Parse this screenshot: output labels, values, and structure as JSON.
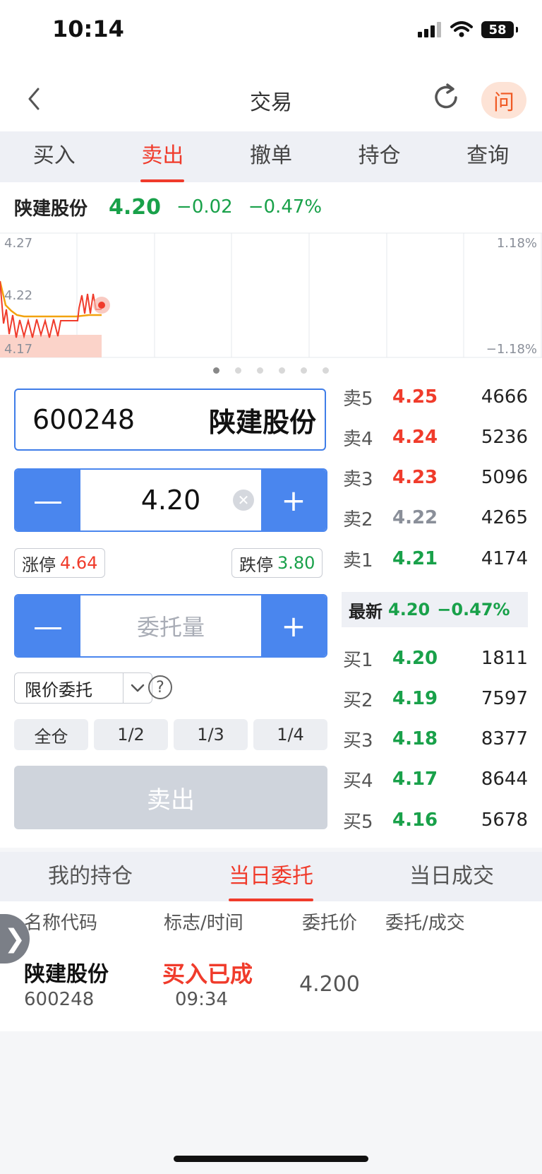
{
  "status": {
    "time": "10:14",
    "battery": "58"
  },
  "header": {
    "title": "交易",
    "ask_label": "问"
  },
  "tabs": [
    {
      "label": "买入"
    },
    {
      "label": "卖出"
    },
    {
      "label": "撤单"
    },
    {
      "label": "持仓"
    },
    {
      "label": "查询"
    }
  ],
  "quote": {
    "name": "陕建股份",
    "price": "4.20",
    "change": "−0.02",
    "change_pct": "−0.47%"
  },
  "chart": {
    "price_labels": {
      "high": "4.27",
      "mid": "4.22",
      "low": "4.17"
    },
    "pct_labels": {
      "high": "1.18%",
      "low": "−1.18%"
    }
  },
  "pager": {
    "count": 6,
    "active": 0
  },
  "form": {
    "stock_code": "600248",
    "stock_name": "陕建股份",
    "minus": "—",
    "plus": "+",
    "price_value": "4.20",
    "clear": "✕",
    "limit_up_label": "涨停",
    "limit_up_value": "4.64",
    "limit_down_label": "跌停",
    "limit_down_value": "3.80",
    "quantity_placeholder": "委托量",
    "order_type": "限价委托",
    "help": "?",
    "qty_buttons": [
      "全仓",
      "1/2",
      "1/3",
      "1/4"
    ],
    "sell_button": "卖出"
  },
  "orderbook": {
    "asks": [
      {
        "label": "卖5",
        "price": "4.25",
        "volume": "4666",
        "color": "red"
      },
      {
        "label": "卖4",
        "price": "4.24",
        "volume": "5236",
        "color": "red"
      },
      {
        "label": "卖3",
        "price": "4.23",
        "volume": "5096",
        "color": "red"
      },
      {
        "label": "卖2",
        "price": "4.22",
        "volume": "4265",
        "color": "gray"
      },
      {
        "label": "卖1",
        "price": "4.21",
        "volume": "4174",
        "color": "green"
      }
    ],
    "latest_label": "最新",
    "latest_price": "4.20",
    "latest_pct": "−0.47%",
    "bids": [
      {
        "label": "买1",
        "price": "4.20",
        "volume": "1811",
        "color": "green"
      },
      {
        "label": "买2",
        "price": "4.19",
        "volume": "7597",
        "color": "green"
      },
      {
        "label": "买3",
        "price": "4.18",
        "volume": "8377",
        "color": "green"
      },
      {
        "label": "买4",
        "price": "4.17",
        "volume": "8644",
        "color": "green"
      },
      {
        "label": "买5",
        "price": "4.16",
        "volume": "5678",
        "color": "green"
      }
    ]
  },
  "bottom_tabs": [
    {
      "label": "我的持仓"
    },
    {
      "label": "当日委托"
    },
    {
      "label": "当日成交"
    }
  ],
  "table": {
    "headers": [
      "名称代码",
      "标志/时间",
      "委托价",
      "委托/成交"
    ],
    "rows": [
      {
        "name": "陕建股份",
        "code": "600248",
        "status": "买入已成",
        "time": "09:34",
        "price": "4.200"
      }
    ]
  },
  "side_handle": "❯",
  "colors": {
    "accent_blue": "#4a86ee",
    "red": "#f03b2b",
    "green": "#19a14a"
  }
}
